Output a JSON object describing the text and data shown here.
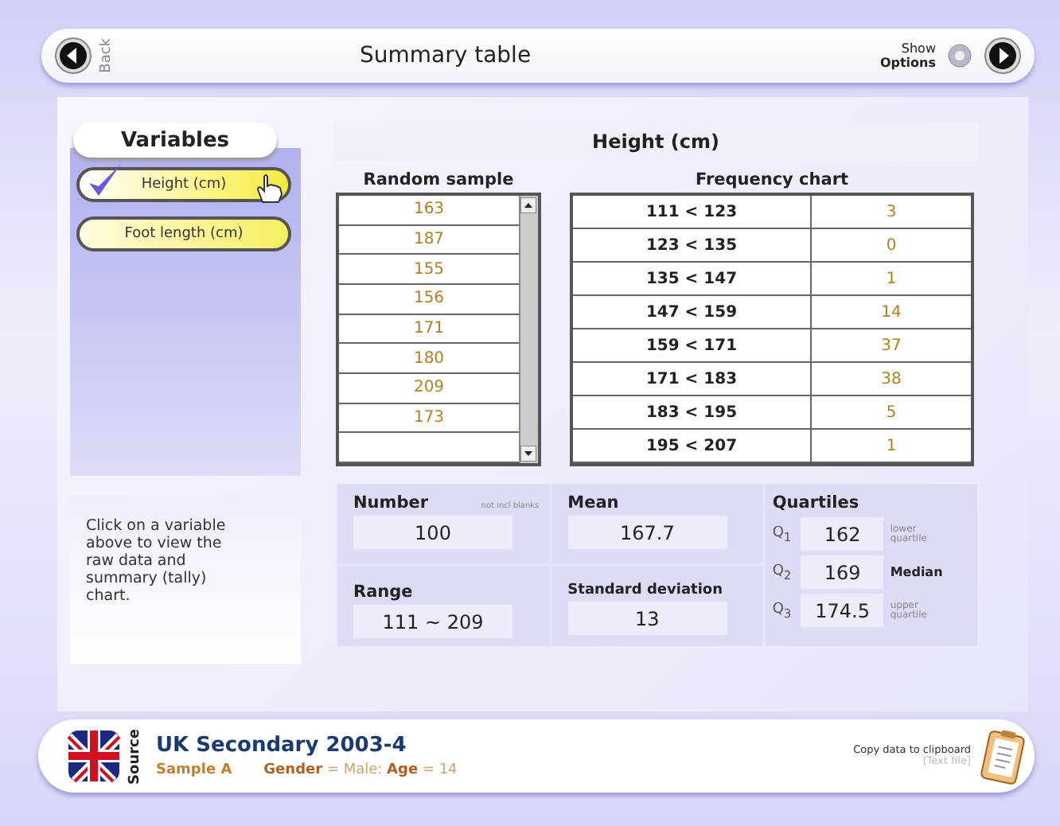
{
  "header": {
    "back_label": "Back",
    "title": "Summary table",
    "options_top": "Show",
    "options_bottom": "Options"
  },
  "variables": {
    "title": "Variables",
    "items": [
      {
        "label": "Height (cm)",
        "selected": true
      },
      {
        "label": "Foot length (cm)",
        "selected": false
      }
    ],
    "hint": "Click on a variable above to view the raw data and summary (tally) chart."
  },
  "table": {
    "title": "Height (cm)",
    "sample_heading": "Random sample",
    "sample": [
      "163",
      "187",
      "155",
      "156",
      "171",
      "180",
      "209",
      "173"
    ],
    "frequency_heading": "Frequency chart",
    "frequency": [
      {
        "interval": "111 < 123",
        "count": "3"
      },
      {
        "interval": "123 < 135",
        "count": "0"
      },
      {
        "interval": "135 < 147",
        "count": "1"
      },
      {
        "interval": "147 < 159",
        "count": "14"
      },
      {
        "interval": "159 < 171",
        "count": "37"
      },
      {
        "interval": "171 < 183",
        "count": "38"
      },
      {
        "interval": "183 < 195",
        "count": "5"
      },
      {
        "interval": "195 < 207",
        "count": "1"
      }
    ]
  },
  "stats": {
    "number": {
      "label": "Number",
      "note": "not incl blanks",
      "value": "100"
    },
    "mean": {
      "label": "Mean",
      "value": "167.7"
    },
    "range": {
      "label": "Range",
      "value": "111 ~ 209"
    },
    "sd": {
      "label": "Standard deviation",
      "value": "13"
    },
    "quartiles": {
      "label": "Quartiles",
      "items": [
        {
          "symbol": "Q$_{1}$",
          "value": "162",
          "note": "lower quartile",
          "kind": "note"
        },
        {
          "symbol": "Q$_{2}$",
          "value": "169",
          "note": "Median",
          "kind": "strong"
        },
        {
          "symbol": "Q$_{3}$",
          "value": "174.5",
          "note": "upper quartile",
          "kind": "note"
        }
      ]
    }
  },
  "source": {
    "label": "Source",
    "title": "UK Secondary 2003-4",
    "sample": "Sample A",
    "filter": "**Gender** = Male:  **Age** = 14",
    "copy_label": "Copy data to clipboard",
    "copy_sub": "[Text file]"
  }
}
